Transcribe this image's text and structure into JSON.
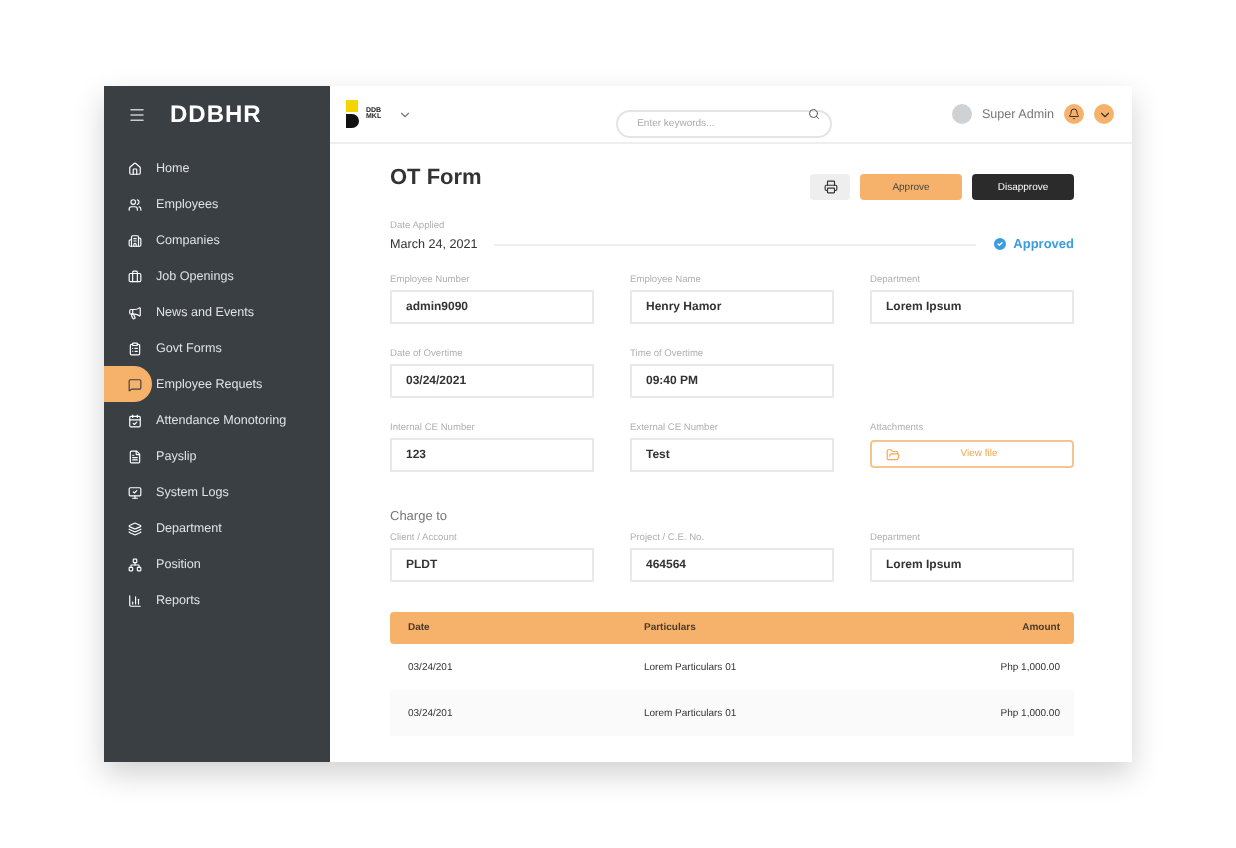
{
  "sidebar": {
    "brand": "DDBHR",
    "items": [
      {
        "label": "Home",
        "selected": false
      },
      {
        "label": "Employees",
        "selected": false
      },
      {
        "label": "Companies",
        "selected": false
      },
      {
        "label": "Job Openings",
        "selected": false
      },
      {
        "label": "News and Events",
        "selected": false
      },
      {
        "label": "Govt Forms",
        "selected": false
      },
      {
        "label": "Employee Requets",
        "selected": true
      },
      {
        "label": "Attendance Monotoring",
        "selected": false
      },
      {
        "label": "Payslip",
        "selected": false
      },
      {
        "label": "System Logs",
        "selected": false
      },
      {
        "label": "Department",
        "selected": false
      },
      {
        "label": "Position",
        "selected": false
      },
      {
        "label": "Reports",
        "selected": false
      }
    ]
  },
  "header": {
    "logo": [
      "DDB",
      "MKL"
    ],
    "search": {
      "placeholder": "Enter keywords..."
    },
    "user": "Super Admin"
  },
  "page": {
    "title": "OT Form",
    "buttons": [
      {
        "label": "Approve",
        "kind": "primary"
      },
      {
        "label": "Disapprove",
        "kind": "dark"
      }
    ],
    "date_applied": {
      "label": "Date Applied",
      "value": "March 24, 2021"
    },
    "status": "Approved",
    "fields": [
      {
        "label": "Employee Number",
        "value": "admin9090",
        "kind": "text"
      },
      {
        "label": "Employee Name",
        "value": "Henry Hamor",
        "kind": "text"
      },
      {
        "label": "Department",
        "value": "Lorem Ipsum",
        "kind": "text"
      },
      {
        "label": "Date of Overtime",
        "value": "03/24/2021",
        "kind": "text"
      },
      {
        "label": "Time of Overtime",
        "value": "09:40 PM",
        "kind": "text"
      },
      {
        "kind": "empty"
      },
      {
        "label": "Internal CE Number",
        "value": "123",
        "kind": "text"
      },
      {
        "label": "External CE Number",
        "value": "Test",
        "kind": "text"
      },
      {
        "label": "Attachments",
        "value": "View file",
        "kind": "file"
      }
    ],
    "charge_to": {
      "title": "Charge to",
      "fields": [
        {
          "label": "Client / Account",
          "value": "PLDT"
        },
        {
          "label": "Project / C.E. No.",
          "value": "464564"
        },
        {
          "label": "Department",
          "value": "Lorem Ipsum"
        }
      ]
    },
    "table": {
      "columns": [
        "Date",
        "Particulars",
        "Amount"
      ],
      "rows": [
        [
          "03/24/201",
          "Lorem Particulars 01",
          "Php 1,000.00"
        ],
        [
          "03/24/201",
          "Lorem Particulars 01",
          "Php 1,000.00"
        ]
      ]
    }
  }
}
